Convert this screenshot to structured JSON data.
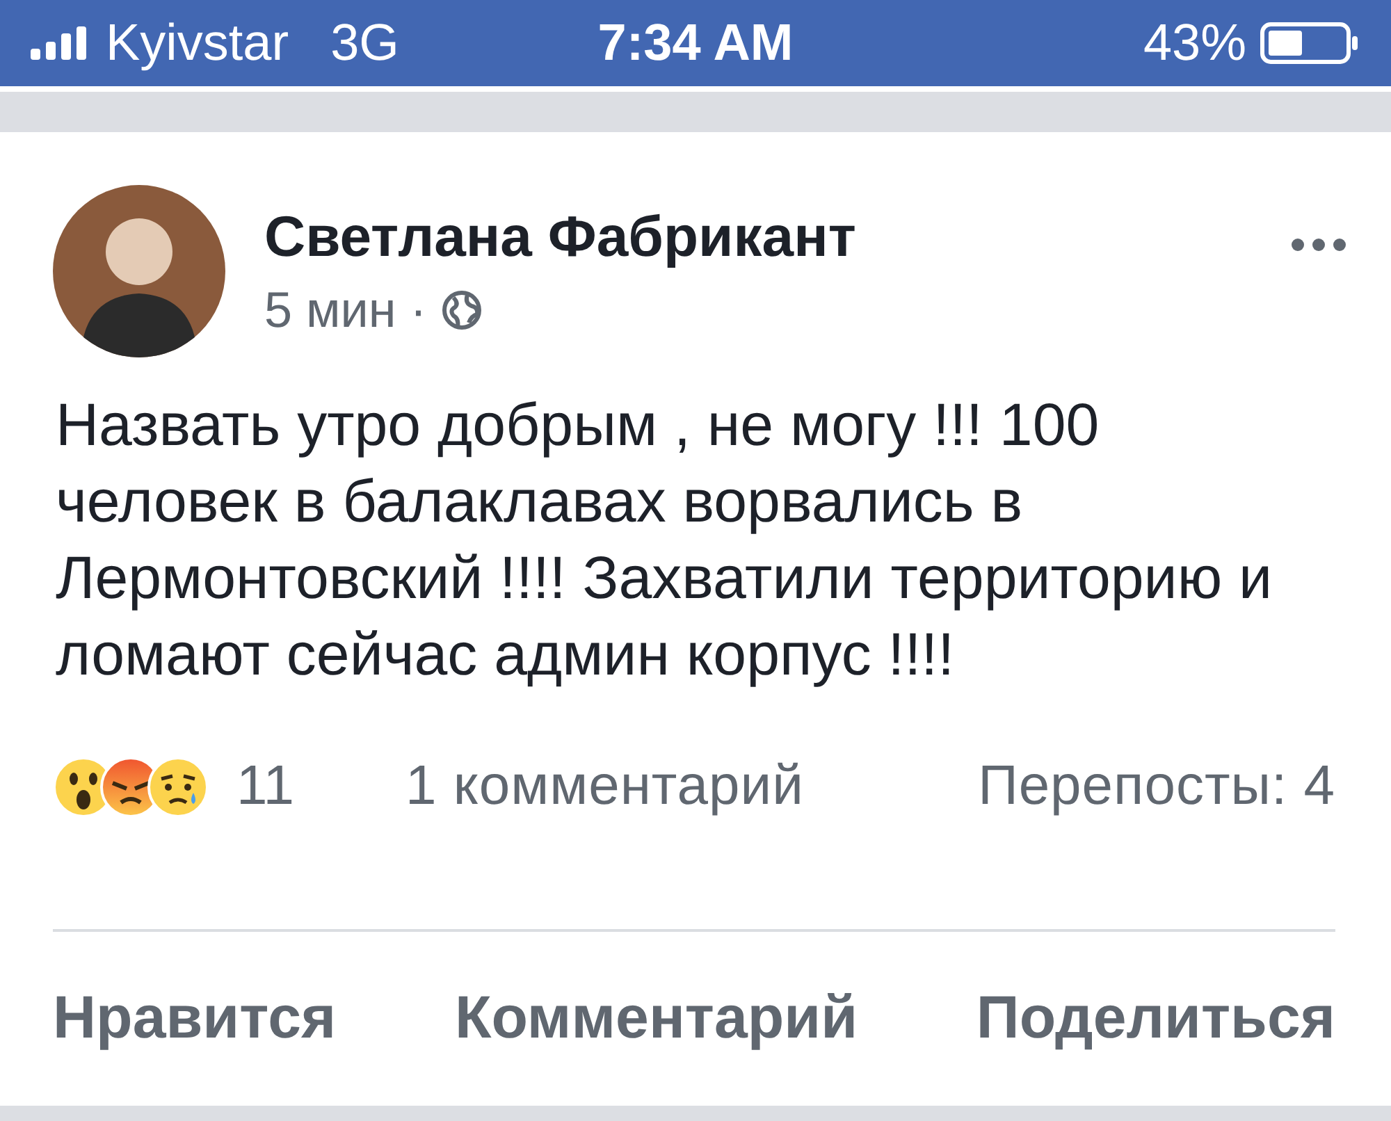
{
  "status_bar": {
    "carrier": "Kyivstar",
    "network": "3G",
    "time": "7:34 AM",
    "battery": "43%"
  },
  "post": {
    "author": "Светлана Фабрикант",
    "time": "5 мин",
    "separator": "·",
    "text": "Назвать утро добрым , не могу !!! 100 человек в балаклавах ворвались в Лермонтовский !!!! Захватили территорию и ломают сейчас админ корпус !!!!",
    "reactions": [
      {
        "kind": "wow"
      },
      {
        "kind": "angry"
      },
      {
        "kind": "sad"
      }
    ],
    "reaction_count": "11",
    "comments": "1 комментарий",
    "shares": "Перепосты: 4"
  },
  "actions": [
    "Нравится",
    "Комментарий",
    "Поделиться"
  ]
}
